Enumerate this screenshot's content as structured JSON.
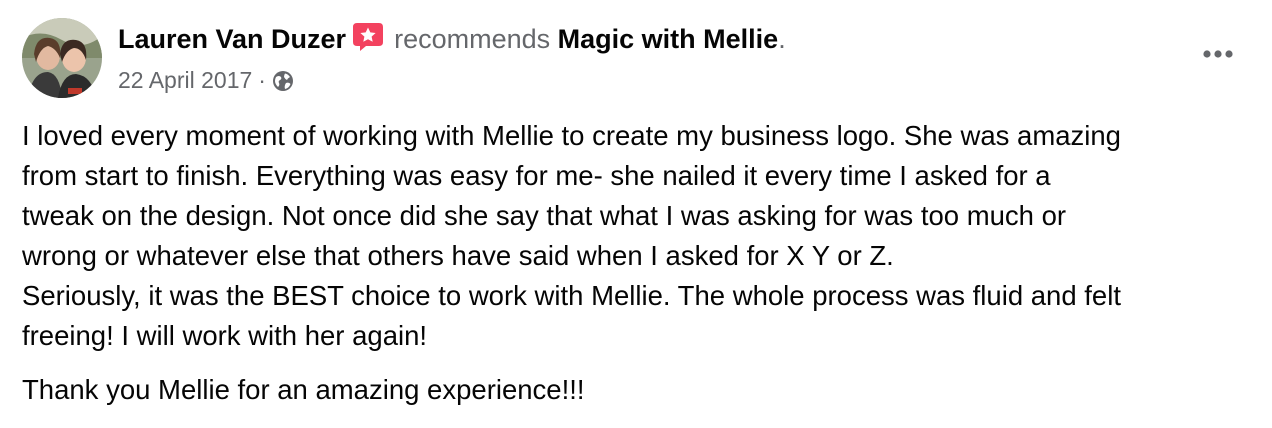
{
  "post": {
    "author": "Lauren Van Duzer",
    "action": "recommends",
    "page": "Magic with Mellie",
    "period": ".",
    "date": "22 April 2017",
    "separator": "·",
    "privacy_icon": "globe-icon",
    "badge_icon": "recommend-star-icon",
    "menu_icon": "more-horizontal-icon",
    "colors": {
      "primary_text": "#050505",
      "secondary_text": "#65676b",
      "badge": "#f3425f"
    },
    "body": {
      "paragraph1_lines": [
        "I loved every moment of working with Mellie to create my business logo. She was amazing",
        "from start to finish. Everything was easy for me- she nailed it every time I asked for a",
        "tweak on the design. Not once did she say that what I was asking for was too much or",
        "wrong or whatever else that others have said when I asked for X Y or Z.",
        "Seriously, it was the BEST choice to work with Mellie. The whole process was fluid and felt",
        "freeing! I will work with her again!"
      ],
      "paragraph2": "Thank you Mellie for an amazing experience!!!"
    }
  }
}
